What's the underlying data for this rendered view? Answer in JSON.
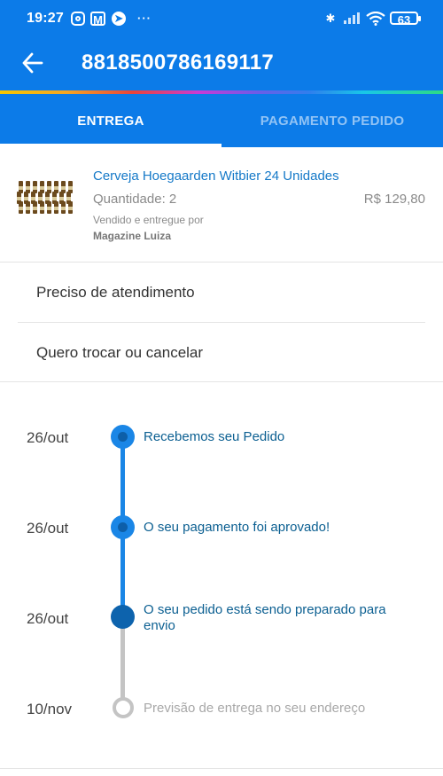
{
  "status_bar": {
    "time": "19:27",
    "battery": "63"
  },
  "header": {
    "order_number": "8818500786169117"
  },
  "tabs": [
    {
      "label": "ENTREGA",
      "active": true
    },
    {
      "label": "PAGAMENTO PEDIDO",
      "active": false
    }
  ],
  "product": {
    "name": "Cerveja Hoegaarden Witbier 24 Unidades",
    "quantity": "Quantidade: 2",
    "price": "R$ 129,80",
    "seller_label": "Vendido e entregue por",
    "seller": "Magazine Luiza"
  },
  "menu": [
    {
      "label": "Preciso de atendimento"
    },
    {
      "label": "Quero trocar ou cancelar"
    }
  ],
  "timeline": [
    {
      "date": "26/out",
      "text": "Recebemos seu Pedido",
      "state": "done"
    },
    {
      "date": "26/out",
      "text": "O seu pagamento foi aprovado!",
      "state": "done"
    },
    {
      "date": "26/out",
      "text": "O seu pedido está sendo preparado para envio",
      "state": "current"
    },
    {
      "date": "10/nov",
      "text": "Previsão de entrega no seu endereço",
      "state": "pending"
    }
  ],
  "colors": {
    "primary": "#0c7be8",
    "timeline_done": "#1a86e6",
    "timeline_pending": "#c4c4c4",
    "event_text": "#0b5f91",
    "product_link": "#1579c8"
  }
}
